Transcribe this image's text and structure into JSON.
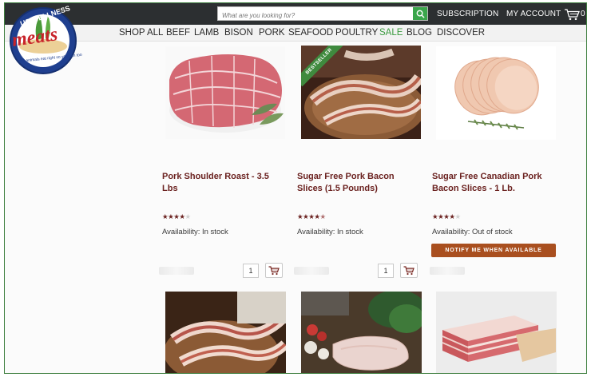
{
  "brand": {
    "logo_top": "US WELLNESS",
    "logo_main": "meats",
    "logo_tagline": "the animals eat right so you can too"
  },
  "topbar": {
    "search_placeholder": "What are you looking for?",
    "subscription": "SUBSCRIPTION",
    "my_account": "MY ACCOUNT",
    "cart_count": "0"
  },
  "nav": {
    "items": [
      {
        "label": "SHOP ALL"
      },
      {
        "label": "BEEF"
      },
      {
        "label": "LAMB"
      },
      {
        "label": "BISON"
      },
      {
        "label": "PORK"
      },
      {
        "label": "SEAFOOD"
      },
      {
        "label": "POULTRY"
      },
      {
        "label": "SALE"
      },
      {
        "label": "BLOG"
      },
      {
        "label": "DISCOVER"
      }
    ],
    "sale_color": "#3a9a3f"
  },
  "products": [
    {
      "title_line1": "Pork Shoulder Roast - 3.5",
      "title_line2": "Lbs",
      "rating": 4,
      "availability": "Availability: In stock",
      "quantity": "1"
    },
    {
      "badge": "BESTSELLER",
      "title_line1": "Sugar Free Pork Bacon",
      "title_line2": "Slices (1.5 Pounds)",
      "rating": 4.5,
      "availability": "Availability: In stock",
      "quantity": "1"
    },
    {
      "title_line1": "Sugar Free Canadian Pork",
      "title_line2": "Bacon Slices - 1 Lb.",
      "rating": 4,
      "availability": "Availability: Out of stock",
      "notify_label": "NOTIFY ME WHEN AVAILABLE"
    }
  ],
  "colors": {
    "topbar": "#2c2f31",
    "title": "#6b2220",
    "notify_button": "#a94f1f",
    "search_button": "#3aa64b"
  }
}
